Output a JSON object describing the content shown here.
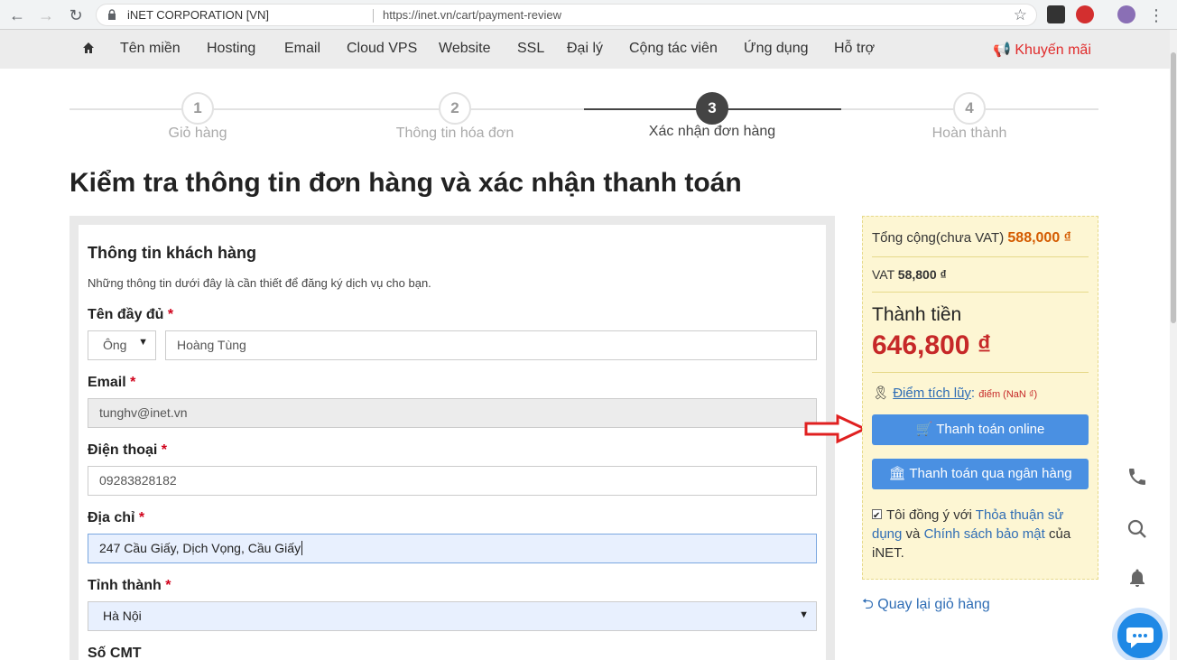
{
  "browser": {
    "site_name": "iNET CORPORATION [VN]",
    "url": "https://inet.vn/cart/payment-review"
  },
  "nav": {
    "items": [
      "Tên miền",
      "Hosting",
      "Email",
      "Cloud VPS",
      "Website",
      "SSL",
      "Đại lý",
      "Cộng tác viên",
      "Ứng dụng",
      "Hỗ trợ"
    ],
    "promo": "Khuyến mãi"
  },
  "steps": [
    {
      "num": "1",
      "label": "Giỏ hàng"
    },
    {
      "num": "2",
      "label": "Thông tin hóa đơn"
    },
    {
      "num": "3",
      "label": "Xác nhận đơn hàng"
    },
    {
      "num": "4",
      "label": "Hoàn thành"
    }
  ],
  "page_title": "Kiểm tra thông tin đơn hàng và xác nhận thanh toán",
  "form": {
    "title": "Thông tin khách hàng",
    "subtitle": "Những thông tin dưới đây là cần thiết để đăng ký dịch vụ cho bạn.",
    "fullname_label": "Tên đầy đủ",
    "salutation": "Ông",
    "fullname": "Hoàng Tùng",
    "email_label": "Email",
    "email": "tunghv@inet.vn",
    "phone_label": "Điện thoại",
    "phone": "09283828182",
    "address_label": "Địa chỉ",
    "address": "247 Cầu Giấy, Dịch Vọng, Cầu Giấy",
    "province_label": "Tỉnh thành",
    "province": "Hà Nội",
    "idcard_label": "Số CMT",
    "required_mark": "*"
  },
  "summary": {
    "subtotal_label": "Tổng cộng(chưa VAT)",
    "subtotal": "588,000 ₫",
    "vat_label": "VAT",
    "vat": "58,800 ₫",
    "total_label": "Thành tiền",
    "total": "646,800 ₫",
    "points_label": "Điểm tích lũy",
    "points_value": "điểm (NaN ₫)",
    "pay_online": "Thanh toán online",
    "pay_bank": "Thanh toán qua ngân hàng",
    "agree_prefix": "Tôi đồng ý với",
    "agree_terms": "Thỏa thuận sử dụng",
    "agree_and": "và",
    "agree_privacy": "Chính sách bảo mật",
    "agree_suffix": "của iNET."
  },
  "back_link": "Quay lại giỏ hàng",
  "colors": {
    "primary_button": "#4a90e2",
    "total_red": "#c62828",
    "summary_bg": "#fdf6d3",
    "promo_red": "#e02b2b"
  }
}
